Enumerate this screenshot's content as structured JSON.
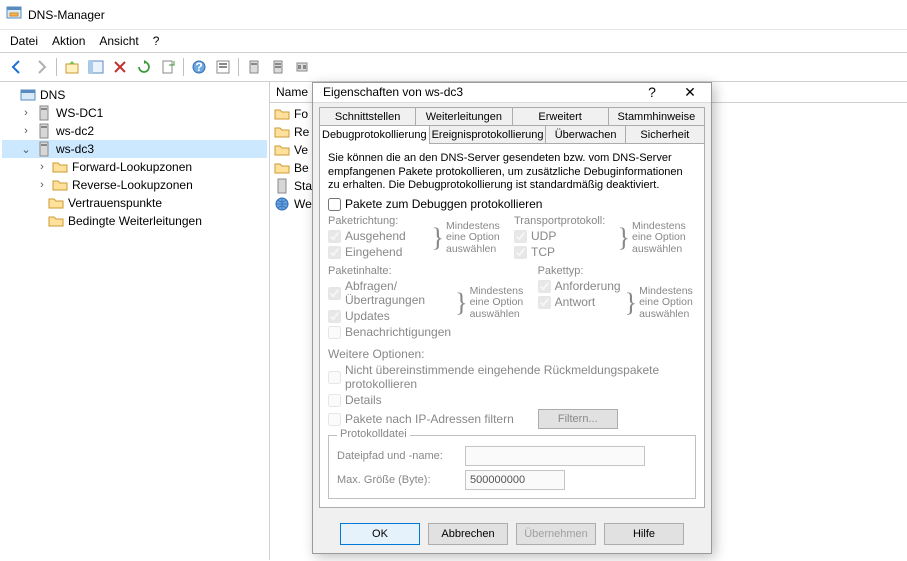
{
  "window": {
    "title": "DNS-Manager"
  },
  "menu": {
    "datei": "Datei",
    "aktion": "Aktion",
    "ansicht": "Ansicht",
    "help": "?"
  },
  "tree": {
    "root": "DNS",
    "servers": [
      "WS-DC1",
      "ws-dc2",
      "ws-dc3"
    ],
    "subnodes": [
      "Forward-Lookupzonen",
      "Reverse-Lookupzonen",
      "Vertrauenspunkte",
      "Bedingte Weiterleitungen"
    ]
  },
  "list": {
    "header": "Name",
    "items": [
      "Fo",
      "Re",
      "Ve",
      "Be",
      "Sta",
      "We"
    ]
  },
  "dialog": {
    "title": "Eigenschaften von ws-dc3",
    "help": "?",
    "tabs_row1": [
      "Schnittstellen",
      "Weiterleitungen",
      "Erweitert",
      "Stammhinweise"
    ],
    "tabs_row2": [
      "Debugprotokollierung",
      "Ereignisprotokollierung",
      "Überwachen",
      "Sicherheit"
    ],
    "desc": "Sie können die an den DNS-Server gesendeten bzw. vom DNS-Server empfangenen Pakete protokollieren, um zusätzliche Debuginformationen zu erhalten. Die Debugprotokollierung ist standardmäßig deaktiviert.",
    "chk_enable": "Pakete zum Debuggen protokollieren",
    "grp_direction": "Paketrichtung:",
    "chk_out": "Ausgehend",
    "chk_in": "Eingehend",
    "grp_transport": "Transportprotokoll:",
    "chk_udp": "UDP",
    "chk_tcp": "TCP",
    "grp_content": "Paketinhalte:",
    "chk_queries": "Abfragen/ Übertragungen",
    "chk_updates": "Updates",
    "chk_notify": "Benachrichtigungen",
    "grp_type": "Pakettyp:",
    "chk_request": "Anforderung",
    "chk_response": "Antwort",
    "note_atleast": "Mindestens eine Option auswählen",
    "grp_other": "Weitere Optionen:",
    "chk_unmatched": "Nicht übereinstimmende eingehende Rückmeldungspakete protokollieren",
    "chk_details": "Details",
    "chk_ipfilter": "Pakete nach IP-Adressen filtern",
    "btn_filter": "Filtern...",
    "fs_logfile": "Protokolldatei",
    "lbl_path": "Dateipfad und -name:",
    "lbl_maxsize": "Max. Größe (Byte):",
    "val_maxsize": "500000000",
    "btn_ok": "OK",
    "btn_cancel": "Abbrechen",
    "btn_apply": "Übernehmen",
    "btn_help": "Hilfe"
  }
}
